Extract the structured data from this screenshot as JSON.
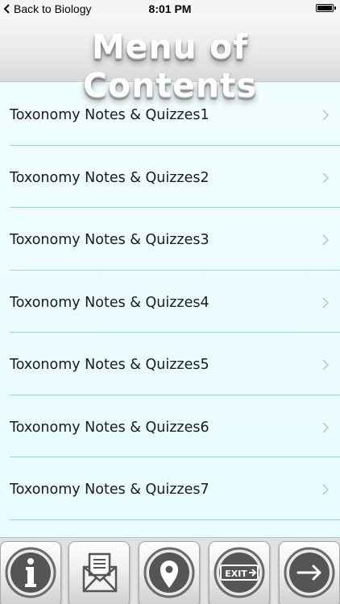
{
  "status_bar": {
    "back_label": "Back to Biology",
    "time": "8:01 PM",
    "battery_level": 1.0
  },
  "header": {
    "title": "Menu of Contents"
  },
  "menu": {
    "items": [
      {
        "label": "Toxonomy Notes & Quizzes1"
      },
      {
        "label": "Toxonomy Notes & Quizzes2"
      },
      {
        "label": "Toxonomy Notes & Quizzes3"
      },
      {
        "label": "Toxonomy Notes & Quizzes4"
      },
      {
        "label": "Toxonomy Notes & Quizzes5"
      },
      {
        "label": "Toxonomy Notes & Quizzes6"
      },
      {
        "label": "Toxonomy Notes & Quizzes7"
      }
    ],
    "chevron_icon": "chevron-right-icon"
  },
  "toolbar": {
    "buttons": [
      {
        "icon": "info-icon"
      },
      {
        "icon": "mail-icon"
      },
      {
        "icon": "location-pin-icon"
      },
      {
        "icon": "exit-icon",
        "icon_text": "EXIT"
      },
      {
        "icon": "arrow-right-icon"
      }
    ]
  },
  "colors": {
    "list_background": "#e9fbfd",
    "separator": "#8fd9df",
    "chevron": "#c7c7cc",
    "toolbar_icon": "#555555"
  }
}
